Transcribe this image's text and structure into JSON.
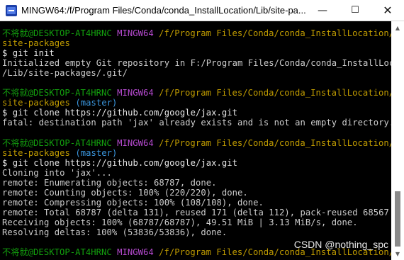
{
  "window": {
    "title": "MINGW64:/f/Program Files/Conda/conda_InstallLocation/Lib/site-pa..."
  },
  "controls": {
    "minimize": "—",
    "maximize": "☐",
    "close": "✕"
  },
  "prompt": {
    "user_host": "不将就@DESKTOP-AT4HRNC",
    "env": "MINGW64",
    "path_line1": "/f/Program Files/Conda/conda_InstallLocation/Lib/",
    "path_line2": "site-packages",
    "branch": "(master)",
    "dollar": "$"
  },
  "commands": {
    "init": "git init",
    "clone": "git clone https://github.com/google/jax.git"
  },
  "output": {
    "init_1": "Initialized empty Git repository in F:/Program Files/Conda/conda_InstallLocation",
    "init_2": "/Lib/site-packages/.git/",
    "fatal": "fatal: destination path 'jax' already exists and is not an empty directory.",
    "cloning": "Cloning into 'jax'...",
    "enumerating": "remote: Enumerating objects: 68787, done.",
    "counting": "remote: Counting objects: 100% (220/220), done.",
    "compressing": "remote: Compressing objects: 100% (108/108), done.",
    "total": "remote: Total 68787 (delta 131), reused 171 (delta 112), pack-reused 68567",
    "receiving": "Receiving objects: 100% (68787/68787), 49.51 MiB | 3.13 MiB/s, done.",
    "resolving": "Resolving deltas: 100% (53836/53836), done."
  },
  "watermark": "CSDN @nothing_spc",
  "scrollbar": {
    "up": "▲",
    "down": "▼"
  }
}
